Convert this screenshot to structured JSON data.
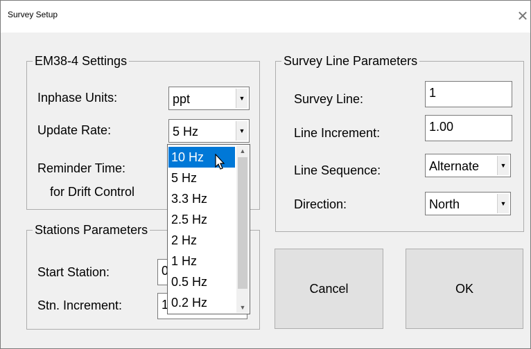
{
  "window": {
    "title": "Survey Setup",
    "close_glyph": "✕"
  },
  "em38": {
    "legend": "EM38-4 Settings",
    "inphase_label": "Inphase Units:",
    "inphase_value": "ppt",
    "update_label": "Update Rate:",
    "update_value": "5 Hz",
    "reminder_label": "Reminder Time:",
    "reminder_sub": "for Drift Control"
  },
  "stations": {
    "legend": "Stations Parameters",
    "start_label": "Start Station:",
    "start_value": "0",
    "increment_label": "Stn. Increment:",
    "increment_value": "1"
  },
  "survey": {
    "legend": "Survey Line Parameters",
    "line_label": "Survey Line:",
    "line_value": "1",
    "increment_label": "Line Increment:",
    "increment_value": "1.00",
    "sequence_label": "Line Sequence:",
    "sequence_value": "Alternate",
    "direction_label": "Direction:",
    "direction_value": "North"
  },
  "buttons": {
    "cancel": "Cancel",
    "ok": "OK"
  },
  "update_rate_options": [
    "10 Hz",
    "5 Hz",
    "3.3 Hz",
    "2.5 Hz",
    "2 Hz",
    "1 Hz",
    "0.5 Hz",
    "0.2 Hz"
  ],
  "highlighted_option": "10 Hz",
  "colors": {
    "selection": "#0078d7",
    "dialog_bg": "#f0f0f0"
  },
  "icons": {
    "close": "close-icon",
    "dropdown": "chevron-down-icon",
    "cursor": "mouse-pointer-icon"
  }
}
